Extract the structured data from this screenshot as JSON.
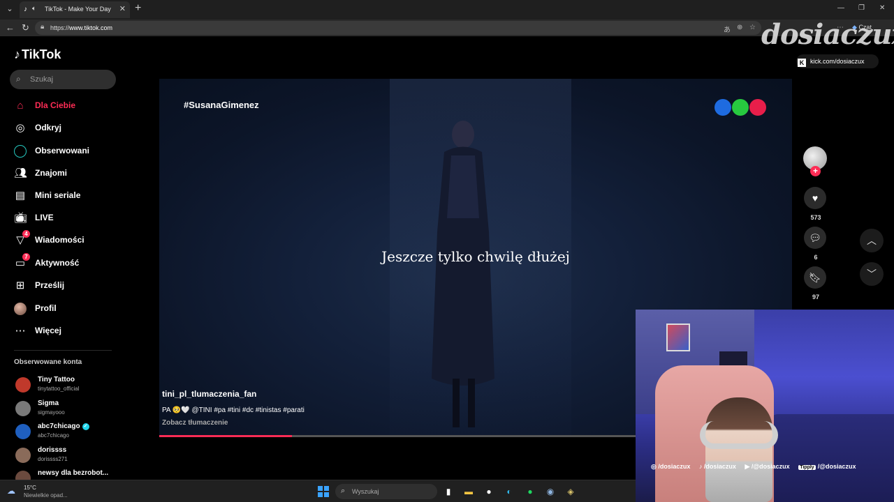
{
  "browser": {
    "tab_title": "TikTok - Make Your Day",
    "url_prefix": "https://",
    "url_host": "www.tiktok.com",
    "copilot_label": "Czat"
  },
  "sidebar": {
    "logo": "TikTok",
    "search_placeholder": "Szukaj",
    "nav": [
      {
        "label": "Dla Ciebie",
        "icon": "home-icon",
        "active": true
      },
      {
        "label": "Odkryj",
        "icon": "compass-icon"
      },
      {
        "label": "Obserwowani",
        "icon": "following-ring-icon"
      },
      {
        "label": "Znajomi",
        "icon": "friends-icon"
      },
      {
        "label": "Mini seriale",
        "icon": "mini-series-icon"
      },
      {
        "label": "LIVE",
        "icon": "live-tv-icon"
      },
      {
        "label": "Wiadomości",
        "icon": "messages-icon",
        "badge": "4"
      },
      {
        "label": "Aktywność",
        "icon": "activity-icon",
        "badge": "7"
      },
      {
        "label": "Prześlij",
        "icon": "upload-icon"
      },
      {
        "label": "Profil",
        "icon": "profile-avatar-icon"
      },
      {
        "label": "Więcej",
        "icon": "more-dots-icon"
      }
    ],
    "followed_title": "Obserwowane konta",
    "accounts": [
      {
        "name": "Tiny Tattoo",
        "handle": "tinytattoo_official",
        "color": "#c0392b"
      },
      {
        "name": "Sigma",
        "handle": "sigmayooo",
        "color": "#7a7a7a"
      },
      {
        "name": "abc7chicago",
        "handle": "abc7chicago",
        "color": "#1f5fbf",
        "verified": true
      },
      {
        "name": "dorissss",
        "handle": "dorissss271",
        "color": "#8a6b5a"
      },
      {
        "name": "newsy dla bezrobot...",
        "handle": "",
        "color": "#6b4a3e"
      }
    ]
  },
  "video": {
    "top_hashtag": "#SusanaGimenez",
    "subtitle": "Jeszcze tylko chwilę dłużej",
    "author": "tini_pl_tlumaczenia_fan",
    "description": "PA 🥺🤍 @TINI #pa #tini #dc #tinistas #parati",
    "translate_link": "Zobacz tłumaczenie",
    "progress": 0.21,
    "logo_dots": [
      "#1e6be0",
      "#27c93f",
      "#e81e4a"
    ]
  },
  "actions": {
    "likes": "573",
    "comments": "6",
    "saves": "97"
  },
  "overlay": {
    "brand": "dosiaczux",
    "kick_text": "kick.com/dosiaczux",
    "socials": [
      {
        "icon": "instagram-icon",
        "text": "/dosiaczux"
      },
      {
        "icon": "tiktok-icon",
        "text": "/dosiaczux"
      },
      {
        "icon": "youtube-icon",
        "text": "/@dosiaczux"
      },
      {
        "icon": "tipply-icon",
        "badge": "Tipply",
        "text": "/@dosiaczux"
      }
    ]
  },
  "taskbar": {
    "weather_temp": "15°C",
    "weather_desc": "Niewielkie opad...",
    "search_placeholder": "Wyszukaj"
  }
}
